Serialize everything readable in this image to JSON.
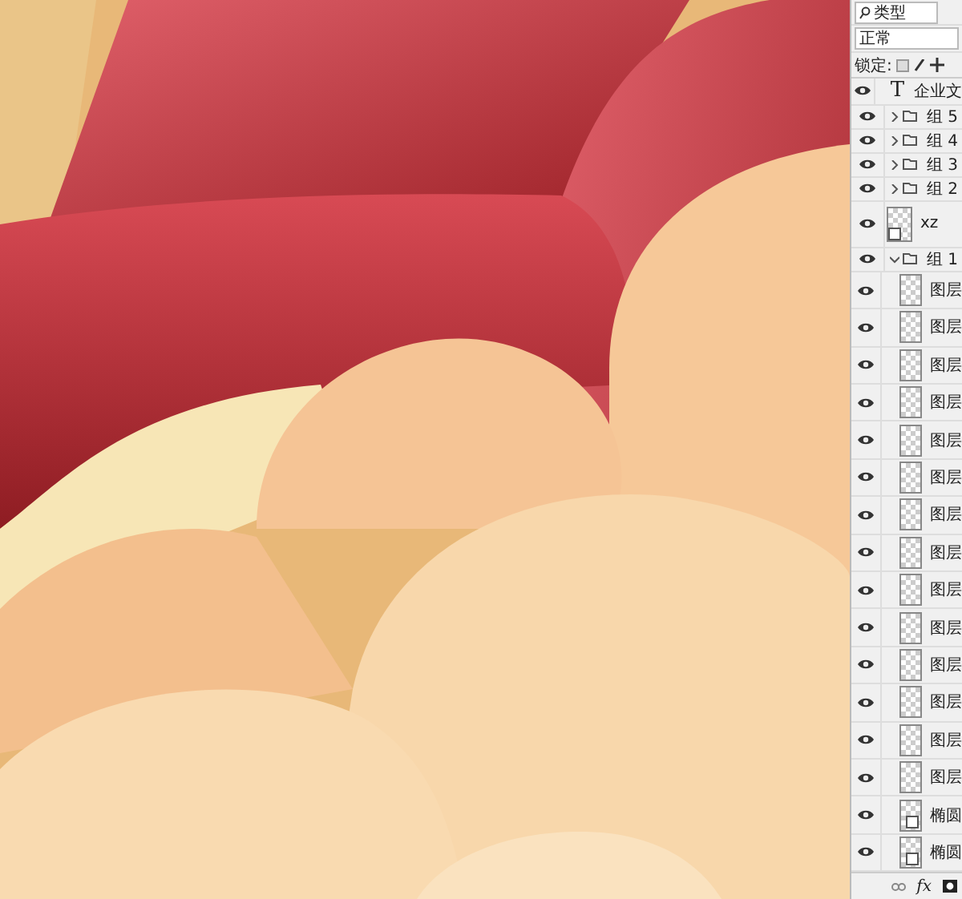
{
  "layers_panel": {
    "filter_kind": "类型",
    "blend_mode": "正常",
    "lock_label": "锁定:",
    "layers": [
      {
        "kind": "text",
        "icon_glyph": "T",
        "name": "企业文",
        "visible": true
      },
      {
        "kind": "group",
        "name": "组 5",
        "visible": true,
        "expanded": false
      },
      {
        "kind": "group",
        "name": "组 4",
        "visible": true,
        "expanded": false
      },
      {
        "kind": "group",
        "name": "组 3",
        "visible": true,
        "expanded": false
      },
      {
        "kind": "group",
        "name": "组 2",
        "visible": true,
        "expanded": false
      },
      {
        "kind": "smart",
        "name": "xz",
        "visible": true
      },
      {
        "kind": "group",
        "name": "组 1",
        "visible": true,
        "expanded": true,
        "children": [
          {
            "kind": "layer",
            "name": "图层",
            "visible": true
          },
          {
            "kind": "layer",
            "name": "图层",
            "visible": true
          },
          {
            "kind": "layer",
            "name": "图层",
            "visible": true
          },
          {
            "kind": "layer",
            "name": "图层",
            "visible": true
          },
          {
            "kind": "layer",
            "name": "图层",
            "visible": true
          },
          {
            "kind": "layer",
            "name": "图层",
            "visible": true
          },
          {
            "kind": "layer",
            "name": "图层",
            "visible": true
          },
          {
            "kind": "layer",
            "name": "图层",
            "visible": true
          },
          {
            "kind": "layer",
            "name": "图层",
            "visible": true
          },
          {
            "kind": "layer",
            "name": "图层",
            "visible": true
          },
          {
            "kind": "layer",
            "name": "图层",
            "visible": true
          },
          {
            "kind": "layer",
            "name": "图层",
            "visible": true
          },
          {
            "kind": "layer",
            "name": "图层",
            "visible": true
          },
          {
            "kind": "layer",
            "name": "图层",
            "visible": true
          },
          {
            "kind": "shape",
            "name": "椭圆",
            "visible": true
          },
          {
            "kind": "shape",
            "name": "椭圆",
            "visible": true
          }
        ]
      }
    ],
    "footer_fx": "fx"
  }
}
